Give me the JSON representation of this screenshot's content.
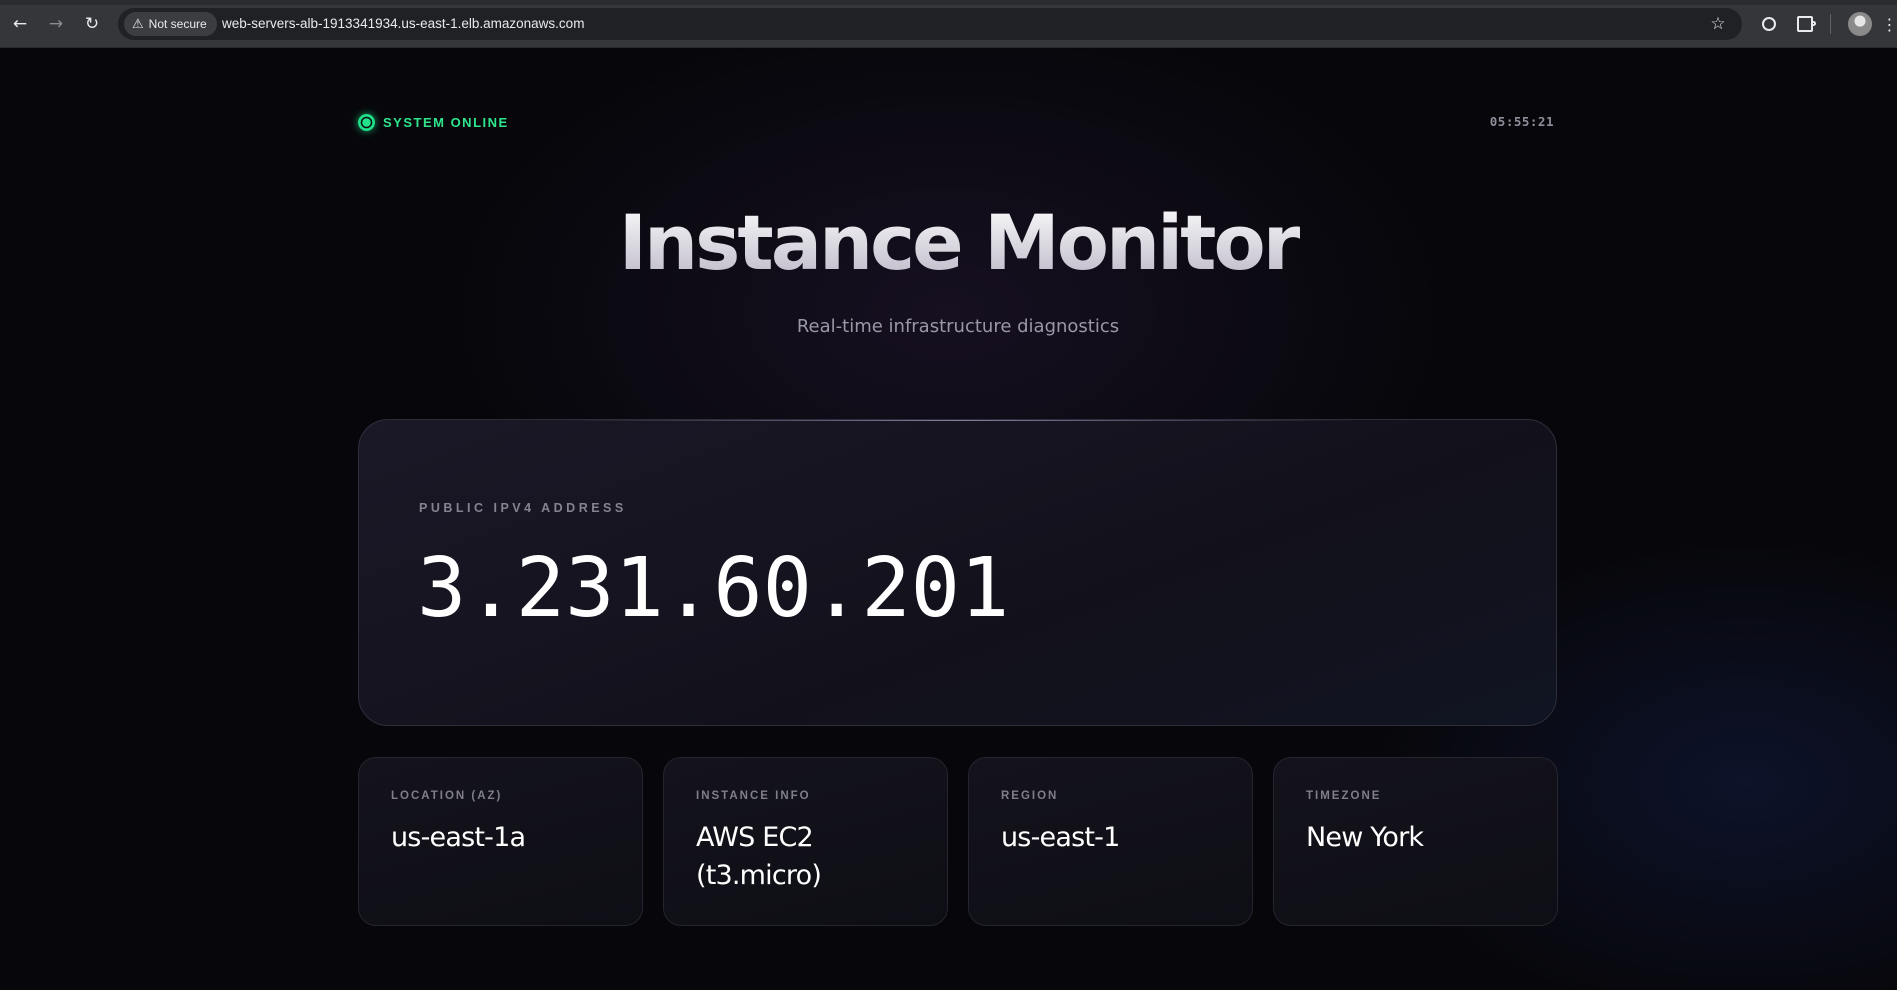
{
  "browser": {
    "security_label": "Not secure",
    "url": "web-servers-alb-1913341934.us-east-1.elb.amazonaws.com",
    "icons": {
      "back": "arrow-left-icon",
      "forward": "arrow-right-icon",
      "reload": "reload-icon",
      "security": "warning-triangle-icon",
      "bookmark": "star-icon",
      "extension_1": "circled-letter-icon",
      "extensions": "puzzle-icon",
      "profile": "avatar",
      "menu": "kebab-menu-icon"
    }
  },
  "header": {
    "status_label": "SYSTEM ONLINE",
    "clock": "05:55:21"
  },
  "hero": {
    "title": "Instance Monitor",
    "subtitle": "Real-time infrastructure diagnostics"
  },
  "ip": {
    "label": "PUBLIC IPV4 ADDRESS",
    "value": "3.231.60.201"
  },
  "cards": [
    {
      "label": "LOCATION (AZ)",
      "value": "us-east-1a"
    },
    {
      "label": "INSTANCE INFO",
      "value": "AWS EC2 (t3.micro)"
    },
    {
      "label": "REGION",
      "value": "us-east-1"
    },
    {
      "label": "TIMEZONE",
      "value": "New York"
    }
  ],
  "colors": {
    "status_green": "#2ee58c",
    "background": "#07070b",
    "card_border": "#2e2d3a"
  }
}
